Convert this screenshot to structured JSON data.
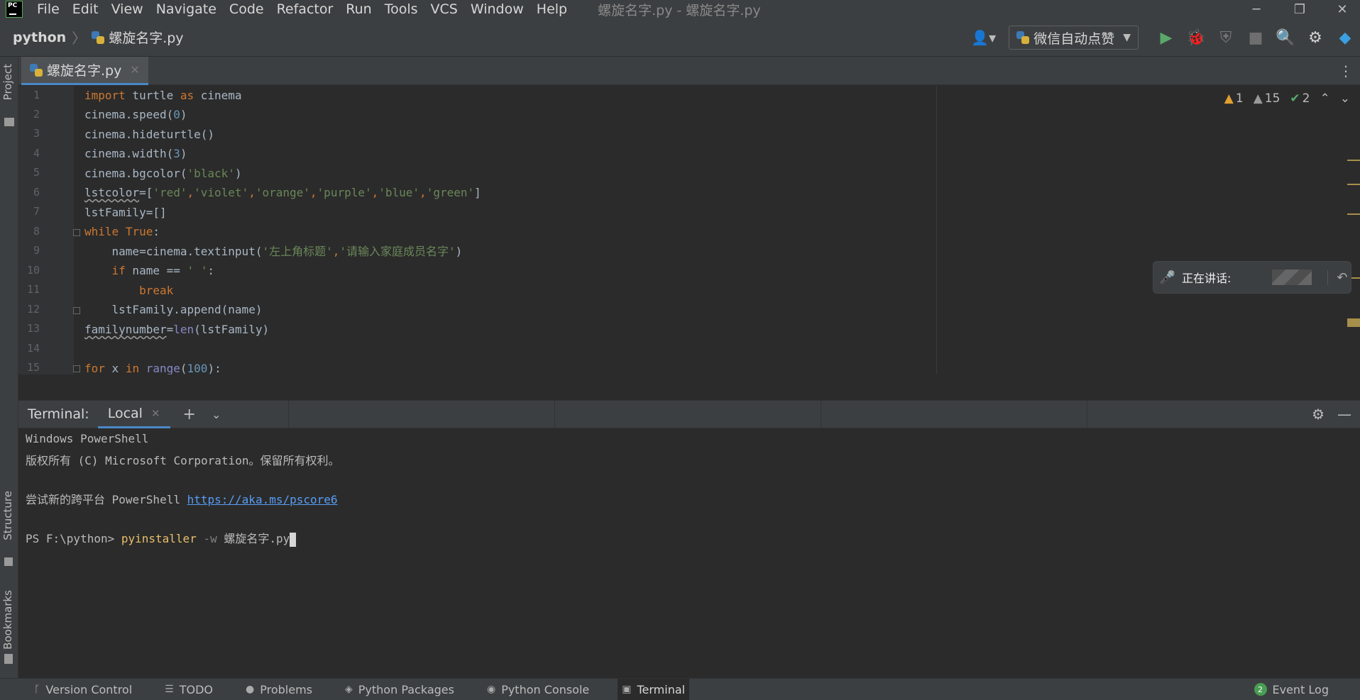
{
  "menubar": {
    "items": [
      "File",
      "Edit",
      "View",
      "Navigate",
      "Code",
      "Refactor",
      "Run",
      "Tools",
      "VCS",
      "Window",
      "Help"
    ],
    "window_title": "螺旋名字.py - 螺旋名字.py"
  },
  "navbar": {
    "project": "python",
    "file": "螺旋名字.py",
    "run_config": "微信自动点赞"
  },
  "sidebar": {
    "project": "Project",
    "structure": "Structure",
    "bookmarks": "Bookmarks"
  },
  "editor": {
    "tab": "螺旋名字.py",
    "line_numbers": [
      "1",
      "2",
      "3",
      "4",
      "5",
      "6",
      "7",
      "8",
      "9",
      "10",
      "11",
      "12",
      "13",
      "14",
      "15"
    ],
    "inspections": {
      "warnings": "1",
      "weak_warnings": "15",
      "typos": "2"
    },
    "lines": [
      "import turtle as cinema",
      "cinema.speed(0)",
      "cinema.hideturtle()",
      "cinema.width(3)",
      "cinema.bgcolor('black')",
      "lstcolor=['red','violet','orange','purple','blue','green']",
      "lstFamily=[]",
      "while True:",
      "    name=cinema.textinput('左上角标题','请输入家庭成员名字')",
      "    if name == ' ':",
      "        break",
      "    lstFamily.append(name)",
      "familynumber=len(lstFamily)",
      "",
      "for x in range(100):"
    ]
  },
  "voice": {
    "label": "正在讲话:"
  },
  "terminal": {
    "title": "Terminal:",
    "tab": "Local",
    "lines": {
      "l1": "Windows PowerShell",
      "l2": "版权所有 (C) Microsoft Corporation。保留所有权利。",
      "l3_prefix": "尝试新的跨平台 PowerShell ",
      "l3_link": "https://aka.ms/pscore6",
      "prompt": "PS F:\\python> ",
      "cmd": "pyinstaller",
      "flag": " -w",
      "arg": " 螺旋名字.py"
    }
  },
  "statusbar": {
    "items": [
      "Version Control",
      "TODO",
      "Problems",
      "Python Packages",
      "Python Console",
      "Terminal"
    ],
    "event_log": "Event Log",
    "event_count": "2"
  }
}
